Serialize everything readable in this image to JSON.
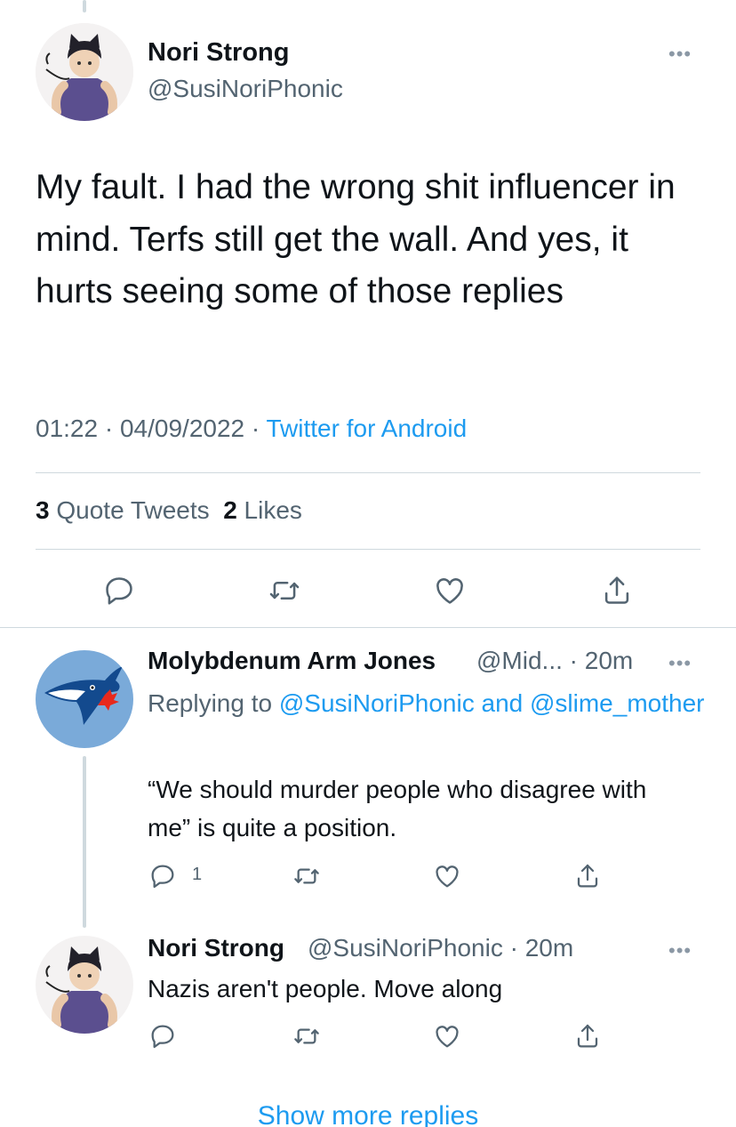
{
  "main_tweet": {
    "author_name": "Nori Strong",
    "author_handle": "@SusiNoriPhonic",
    "more_label": "•••",
    "text": "My fault. I had the wrong shit influencer in mind. Terfs still get the wall. And yes, it hurts seeing some of those replies",
    "time": "01:22",
    "date": "04/09/2022",
    "separator": " · ",
    "source": "Twitter for Android",
    "quote_tweets_count": "3",
    "quote_tweets_label": "Quote Tweets",
    "likes_count": "2",
    "likes_label": "Likes"
  },
  "replies": [
    {
      "author_name": "Molybdenum Arm Jones",
      "author_handle": "@Mid...",
      "time": "· 20m",
      "replying_prefix": "Replying to",
      "replying_to": "@SusiNoriPhonic and @slime_mother",
      "text": "“We should murder people who disagree with me” is quite a position.",
      "reply_count": "1",
      "more_label": "•••"
    },
    {
      "author_name": "Nori Strong",
      "author_handle": "@SusiNoriPhonic",
      "time": "· 20m",
      "text": "Nazis aren't people. Move along",
      "more_label": "•••"
    }
  ],
  "show_more_label": "Show more replies",
  "colors": {
    "link": "#1d9bf0",
    "secondary_text": "#536471",
    "divider": "#cfd9de",
    "avatar_bluejays_bg": "#7aaad9"
  },
  "icons": [
    "reply-icon",
    "retweet-icon",
    "like-icon",
    "share-icon",
    "more-icon"
  ]
}
